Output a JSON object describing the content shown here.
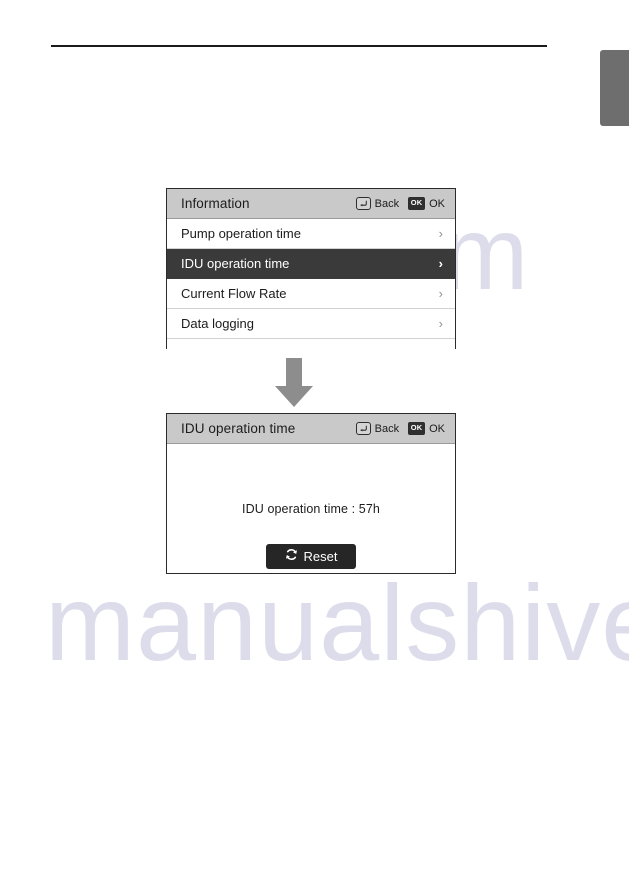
{
  "page": {
    "rule": "horizontal-divider",
    "side_tab": "chapter-tab"
  },
  "watermark": {
    "line1": "manualshive",
    "line2": ".com"
  },
  "menu_panel": {
    "title": "Information",
    "keys": {
      "back_label": "Back",
      "back_icon": "return-arrow-icon",
      "ok_label": "OK",
      "ok_icon": "ok-key-icon",
      "ok_icon_text": "OK"
    },
    "rows": [
      {
        "label": "Pump operation time",
        "chevron": "›",
        "selected": false
      },
      {
        "label": "IDU operation time",
        "chevron": "›",
        "selected": true
      },
      {
        "label": "Current Flow Rate",
        "chevron": "›",
        "selected": false
      },
      {
        "label": "Data logging",
        "chevron": "›",
        "selected": false
      }
    ],
    "colors": {
      "header_bg": "#c9c9c9",
      "selected_bg": "#3a3a3a",
      "text": "#1c1c1c"
    }
  },
  "flow": {
    "arrow": "down-arrow-icon"
  },
  "detail_panel": {
    "title": "IDU operation time",
    "keys": {
      "back_label": "Back",
      "back_icon": "return-arrow-icon",
      "ok_label": "OK",
      "ok_icon": "ok-key-icon",
      "ok_icon_text": "OK"
    },
    "value_text": "IDU operation time : 57h",
    "reset_button": {
      "label": "Reset",
      "icon": "refresh-icon"
    },
    "colors": {
      "header_bg": "#c9c9c9",
      "button_bg": "#262626"
    }
  }
}
